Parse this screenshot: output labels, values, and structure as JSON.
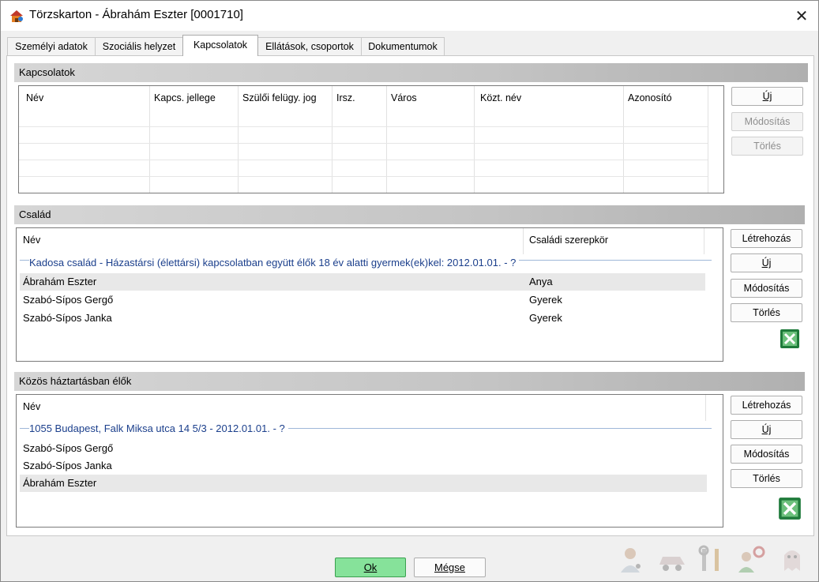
{
  "window": {
    "title": "Törzskarton - Ábrahám Eszter [0001710]"
  },
  "tabs": [
    {
      "label": "Személyi adatok"
    },
    {
      "label": "Szociális helyzet"
    },
    {
      "label": "Kapcsolatok"
    },
    {
      "label": "Ellátások, csoportok"
    },
    {
      "label": "Dokumentumok"
    }
  ],
  "active_tab": "Kapcsolatok",
  "kapcsolatok": {
    "header": "Kapcsolatok",
    "columns": [
      "Név",
      "Kapcs. jellege",
      "Szülői felügy. jog",
      "Irsz.",
      "Város",
      "Közt. név",
      "Azonosító"
    ],
    "rows": [],
    "buttons": {
      "new": "Új",
      "modify": "Módosítás",
      "delete": "Törlés"
    }
  },
  "csalad": {
    "header": "Család",
    "columns": [
      "Név",
      "Családi szerepkör"
    ],
    "group": "Kadosa család - Házastársi (élettársi) kapcsolatban együtt élők 18 év alatti gyermek(ek)kel: 2012.01.01. - ?",
    "rows": [
      {
        "name": "Ábrahám Eszter",
        "role": "Anya"
      },
      {
        "name": "Szabó-Sípos Gergő",
        "role": "Gyerek"
      },
      {
        "name": "Szabó-Sípos Janka",
        "role": "Gyerek"
      }
    ],
    "buttons": {
      "create": "Létrehozás",
      "new": "Új",
      "modify": "Módosítás",
      "delete": "Törlés"
    }
  },
  "haztartas": {
    "header": "Közös háztartásban élők",
    "columns": [
      "Név"
    ],
    "group": "1055 Budapest, Falk Miksa utca 14 5/3 - 2012.01.01. - ?",
    "rows": [
      {
        "name": "Szabó-Sípos Gergő"
      },
      {
        "name": "Szabó-Sípos Janka"
      },
      {
        "name": "Ábrahám Eszter"
      }
    ],
    "buttons": {
      "create": "Létrehozás",
      "new": "Új",
      "modify": "Módosítás",
      "delete": "Törlés"
    }
  },
  "footer": {
    "ok": "Ok",
    "cancel": "Mégse"
  },
  "toolbar_icons": [
    "doctor-icon",
    "car-icon",
    "tools-icon",
    "settings-person-icon",
    "ghost-icon"
  ],
  "colors": {
    "ok_button": "#86e29a",
    "group_text": "#1b3f8c",
    "selected_row": "#e8e8e8"
  }
}
